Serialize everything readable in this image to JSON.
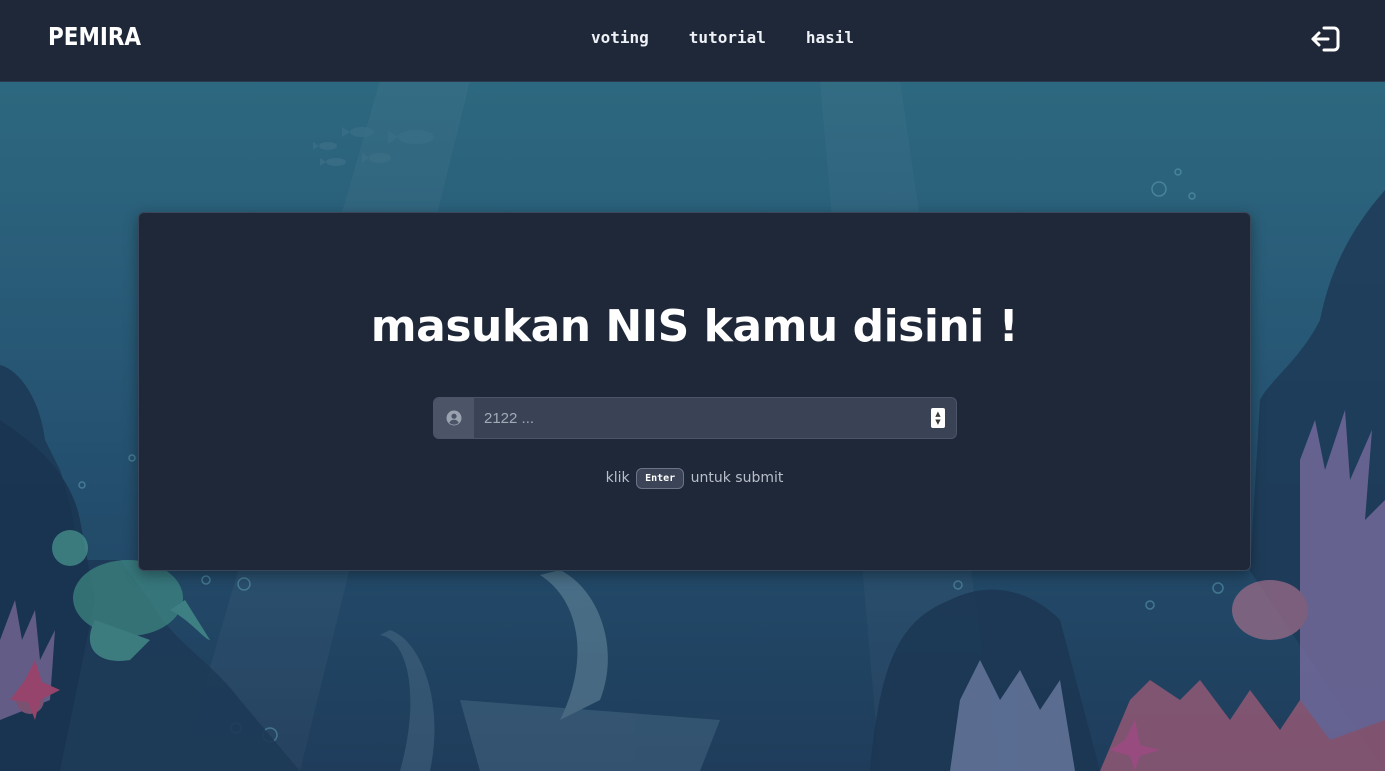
{
  "navbar": {
    "brand": "PEMIRA",
    "links": [
      {
        "label": "voting"
      },
      {
        "label": "tutorial"
      },
      {
        "label": "hasil"
      }
    ],
    "logout_icon": "logout-icon"
  },
  "card": {
    "title": "masukan NIS kamu disini !",
    "input": {
      "placeholder": "2122 ...",
      "value": "",
      "icon": "user-circle-icon"
    },
    "hint": {
      "before": "klik",
      "key": "Enter",
      "after": "untuk submit"
    }
  },
  "colors": {
    "navbar_bg": "#1f2839",
    "card_bg": "#1f2839",
    "input_bg": "#394355",
    "ocean_top": "#2e6d82",
    "ocean_bottom": "#1f3c5b"
  }
}
